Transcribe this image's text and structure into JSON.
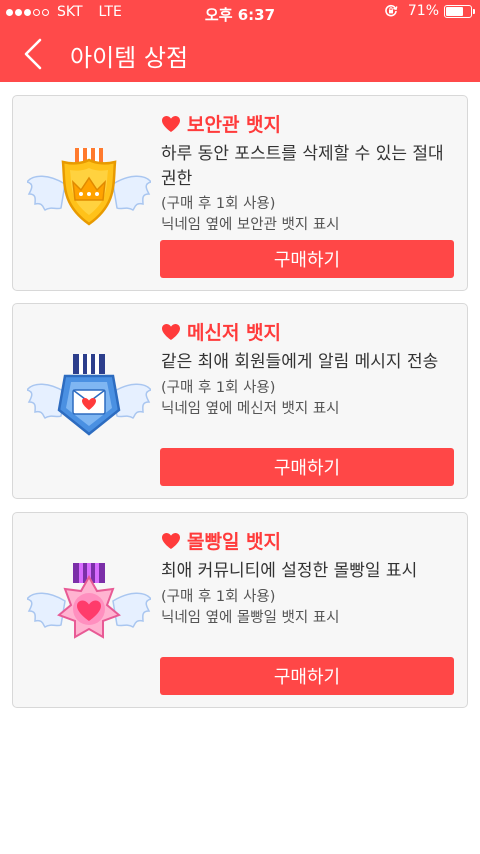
{
  "status_bar": {
    "carrier": "SKT",
    "network": "LTE",
    "time": "오후 6:37",
    "battery_percent": "71%",
    "battery_level": 0.71,
    "signal_bars_filled": 3,
    "signal_bars_total": 5
  },
  "nav": {
    "title": "아이템 상점",
    "back_icon": "chevron-left-icon"
  },
  "colors": {
    "accent": "#ff4a4a",
    "title_red": "#ff3b3b",
    "card_bg": "#f7f7f7"
  },
  "items": [
    {
      "name": "보안관 뱃지",
      "description": "하루 동안 포스트를 삭제할 수 있는 절대 권한",
      "note1": "(구매 후 1회 사용)",
      "note2": "닉네임 옆에 보안관 뱃지 표시",
      "buy_label": "구매하기",
      "icon": "sheriff-badge-icon"
    },
    {
      "name": "메신저 뱃지",
      "description": "같은 최애 회원들에게 알림 메시지 전송",
      "note1": "(구매 후 1회 사용)",
      "note2": "닉네임 옆에 메신저 뱃지 표시",
      "buy_label": "구매하기",
      "icon": "messenger-badge-icon"
    },
    {
      "name": "몰빵일 뱃지",
      "description": "최애 커뮤니티에 설정한 몰빵일 표시",
      "note1": "(구매 후 1회 사용)",
      "note2": "닉네임 옆에 몰빵일 뱃지 표시",
      "buy_label": "구매하기",
      "icon": "star-heart-badge-icon"
    }
  ]
}
